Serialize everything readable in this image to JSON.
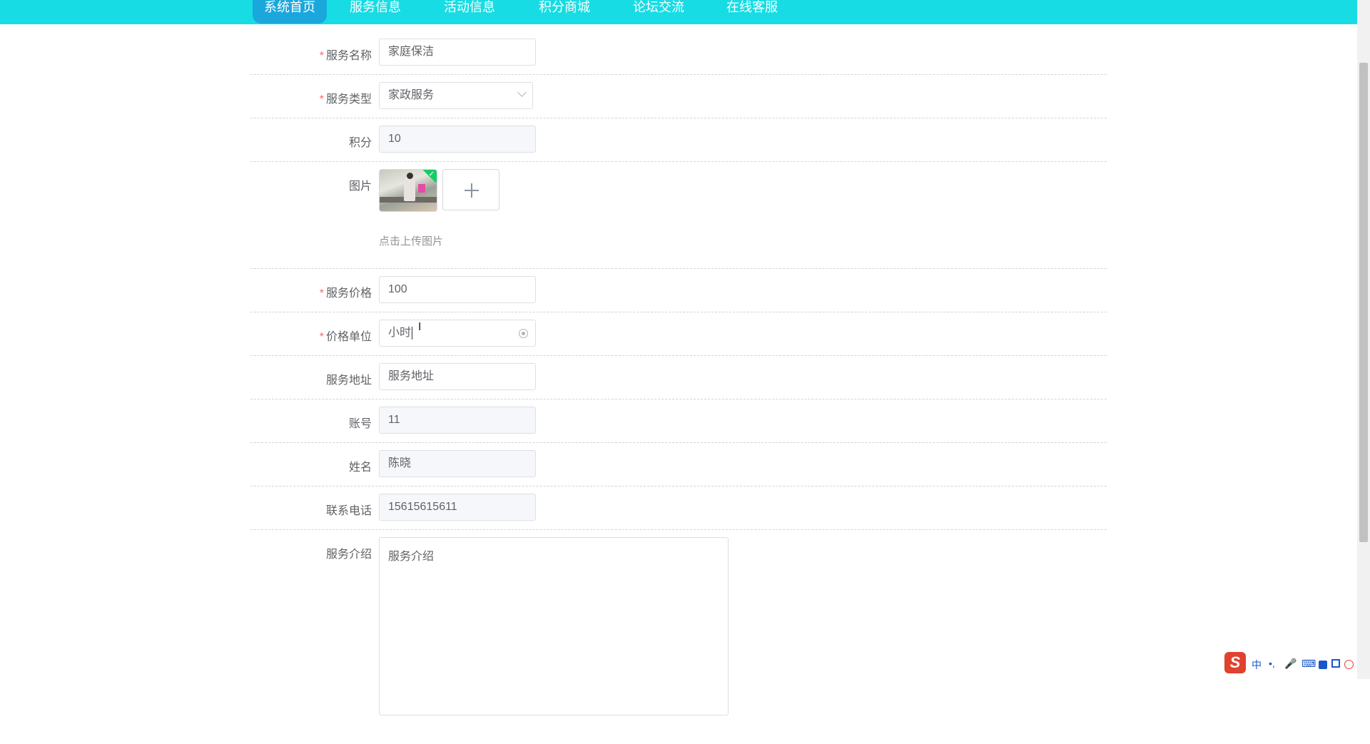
{
  "nav": {
    "items": [
      "系统首页",
      "服务信息",
      "活动信息",
      "积分商城",
      "论坛交流",
      "在线客服"
    ]
  },
  "form": {
    "service_name": {
      "label": "服务名称",
      "value": "家庭保洁"
    },
    "service_type": {
      "label": "服务类型",
      "value": "家政服务"
    },
    "points": {
      "label": "积分",
      "value": "10"
    },
    "image": {
      "label": "图片",
      "tip": "点击上传图片"
    },
    "price": {
      "label": "服务价格",
      "value": "100"
    },
    "price_unit": {
      "label": "价格单位",
      "value": "小时"
    },
    "address": {
      "label": "服务地址",
      "placeholder": "服务地址"
    },
    "account": {
      "label": "账号",
      "value": "11"
    },
    "name": {
      "label": "姓名",
      "value": "陈晓"
    },
    "phone": {
      "label": "联系电话",
      "value": "15615615611"
    },
    "intro": {
      "label": "服务介绍",
      "placeholder": "服务介绍"
    },
    "required_mark": "*"
  },
  "ime": {
    "logo": "S",
    "lang": "中",
    "punct": "•,",
    "mic": "🎤",
    "keyboard": "⌨"
  }
}
